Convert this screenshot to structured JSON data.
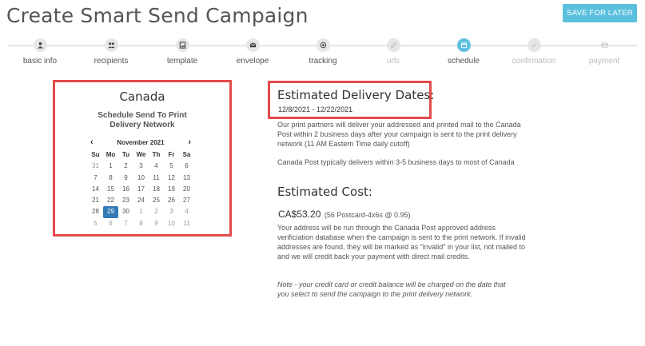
{
  "page": {
    "title": "Create Smart Send Campaign",
    "save_button": "SAVE FOR LATER"
  },
  "wizard": {
    "steps": [
      {
        "label": "basic info",
        "icon": "user-icon",
        "state": "done"
      },
      {
        "label": "recipients",
        "icon": "users-icon",
        "state": "done"
      },
      {
        "label": "template",
        "icon": "image-icon",
        "state": "done"
      },
      {
        "label": "envelope",
        "icon": "envelope-icon",
        "state": "done"
      },
      {
        "label": "tracking",
        "icon": "target-icon",
        "state": "done"
      },
      {
        "label": "urls",
        "icon": "link-icon",
        "state": "disabled"
      },
      {
        "label": "schedule",
        "icon": "calendar-icon",
        "state": "active"
      },
      {
        "label": "confirmation",
        "icon": "check-icon",
        "state": "disabled"
      },
      {
        "label": "payment",
        "icon": "credit-card-icon",
        "state": "disabled"
      }
    ]
  },
  "calendar": {
    "country": "Canada",
    "subtitle_line1": "Schedule Send To Print",
    "subtitle_line2": "Delivery Network",
    "month": "November 2021",
    "prev": "‹",
    "next": "›",
    "weekdays": [
      "Su",
      "Mo",
      "Tu",
      "We",
      "Th",
      "Fr",
      "Sa"
    ],
    "weeks": [
      [
        "31",
        "1",
        "2",
        "3",
        "4",
        "5",
        "6"
      ],
      [
        "7",
        "8",
        "9",
        "10",
        "11",
        "12",
        "13"
      ],
      [
        "14",
        "15",
        "16",
        "17",
        "18",
        "19",
        "20"
      ],
      [
        "21",
        "22",
        "23",
        "24",
        "25",
        "26",
        "27"
      ],
      [
        "28",
        "29",
        "30",
        "1",
        "2",
        "3",
        "4"
      ],
      [
        "5",
        "6",
        "7",
        "8",
        "9",
        "10",
        "11"
      ]
    ],
    "selected": "29"
  },
  "delivery": {
    "title": "Estimated Delivery Dates:",
    "range": "12/8/2021 - 12/22/2021",
    "para1": "Our print partners will deliver your addressed and printed mail to the Canada Post within 2 business days after your campaign is sent to the print delivery network (11 AM Eastern Time daily cutoff)",
    "para2": "Canada Post typically delivers within 3-5 business days to most of Canada"
  },
  "cost": {
    "title": "Estimated Cost:",
    "amount": "CA$53.20",
    "detail": "(56 Postcard-4x6s @ 0.95)",
    "para": "Your address will be run through the Canada Post approved address verificiation database when the campaign is sent to the print network. If invalid addresses are found, they will be marked as \"invalid\" in your list, not mailed to and we will credit back your payment with direct mail credits.",
    "note": "Note - your credit card or credit balance will be charged on the date that you select to send the campaign to the print delivery network."
  },
  "colors": {
    "accent": "#5bc0de",
    "highlight_border": "#e34b4b",
    "selected_day": "#337ab7"
  }
}
